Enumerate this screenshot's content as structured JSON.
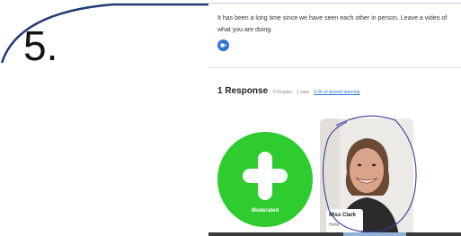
{
  "step": {
    "number": "5."
  },
  "prompt": {
    "text": "It has been a long time since we have seen each other in person.  Leave a video of what you are doing."
  },
  "responses": {
    "count_label": "1 Response",
    "replies": "0 Replies",
    "views": "1 view",
    "learning_link": "0.0h of shared learning"
  },
  "moderated_card": {
    "label": "Moderated",
    "icon": "plus-icon",
    "color": "#2ecc2e"
  },
  "video_card": {
    "author": "Miss Clark",
    "message": "Hello"
  },
  "colors": {
    "accent_blue": "#2e73d4",
    "frame_navy": "#1f3a73",
    "scribble": "#3b3fa0"
  }
}
